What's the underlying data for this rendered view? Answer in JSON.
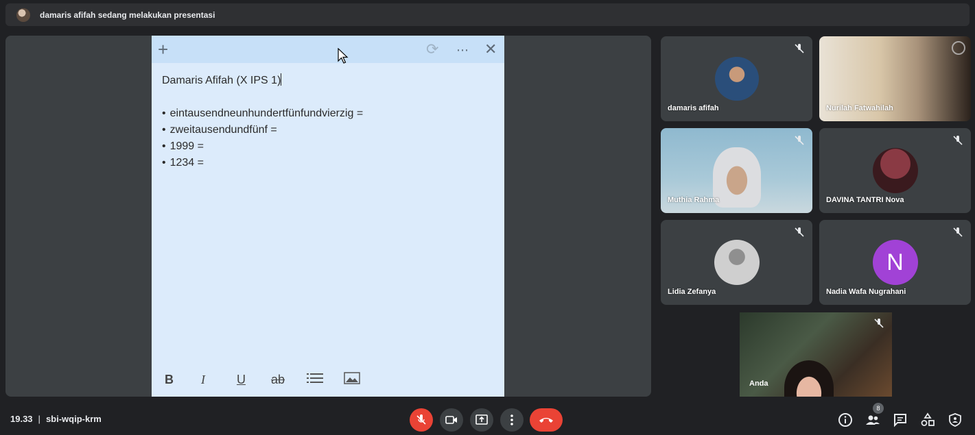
{
  "banner": {
    "text": "damaris afifah sedang melakukan presentasi"
  },
  "note": {
    "title": "Damaris Afifah (X IPS 1)",
    "items": [
      "eintausendneunhundertfünfundvierzig =",
      "zweitausendundfünf =",
      "1999 =",
      "1234 ="
    ],
    "format_buttons": [
      "B",
      "I",
      "U",
      "ab"
    ]
  },
  "participants": [
    {
      "name": "damaris afifah"
    },
    {
      "name": "Nurilah Fatwahilah"
    },
    {
      "name": "Muthia Rahma"
    },
    {
      "name": "DAVINA TANTRI Nova"
    },
    {
      "name": "Lidia Zefanya"
    },
    {
      "name": "Nadia Wafa Nugrahani",
      "initial": "N",
      "color": "#a142d6"
    }
  ],
  "self_view": {
    "name": "Anda"
  },
  "meeting": {
    "time": "19.33",
    "separator": "|",
    "code": "sbi-wqip-krm"
  },
  "people_count": "8",
  "colors": {
    "end_call": "#ea4335",
    "mic_off": "#ea4335",
    "note_bg": "#dcebfb",
    "note_toolbar": "#c7e0f8"
  }
}
